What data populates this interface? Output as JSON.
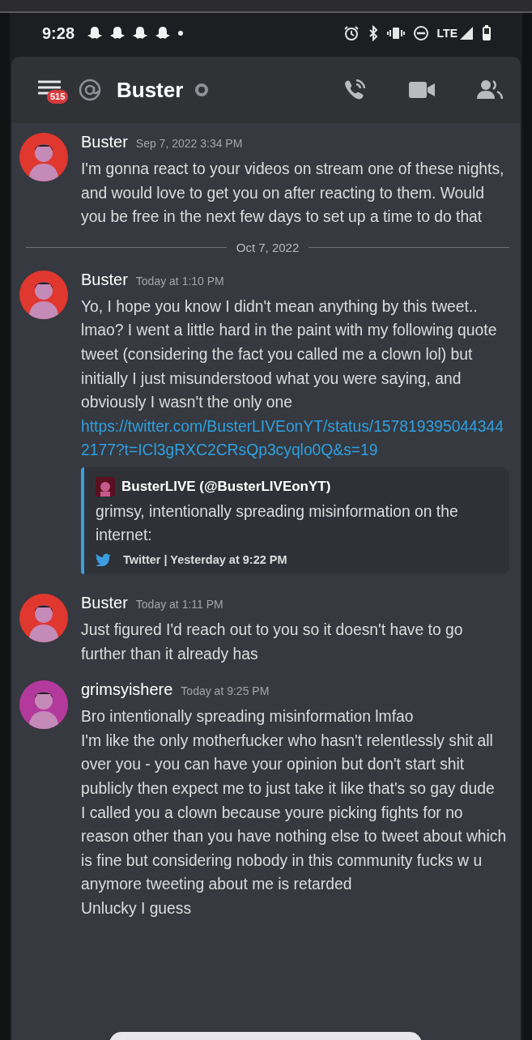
{
  "status_bar": {
    "time": "9:28",
    "network": "LTE"
  },
  "header": {
    "badge": "515",
    "title": "Buster"
  },
  "feed": [
    {
      "kind": "message",
      "author": "Buster",
      "timestamp": "Sep 7, 2022 3:34 PM",
      "color": "#e0372e",
      "lines": [
        "I'm gonna react to your videos on stream one of these nights, and would love to get you on after reacting to them. Would you be free in the next few days to set up a time to do that"
      ]
    },
    {
      "kind": "divider",
      "label": "Oct 7, 2022"
    },
    {
      "kind": "message",
      "author": "Buster",
      "timestamp": "Today at 1:10 PM",
      "color": "#e0372e",
      "lines": [
        "Yo, I hope you know I didn't mean anything by this tweet.. lmao? I went a little hard in the paint with my following quote tweet (considering the fact you called me a clown lol) but initially I just misunderstood what you were saying, and obviously I wasn't the only one"
      ],
      "link": "https://twitter.com/BusterLIVEonYT/status/1578193950443442177?t=ICl3gRXC2CRsQp3cyqlo0Q&s=19",
      "embed": {
        "author": "BusterLIVE (@BusterLIVEonYT)",
        "description": "grimsy, intentionally spreading misinformation on the internet:",
        "footer": "Twitter | Yesterday at 9:22 PM"
      }
    },
    {
      "kind": "message",
      "author": "Buster",
      "timestamp": "Today at 1:11 PM",
      "color": "#e0372e",
      "lines": [
        "Just figured I'd reach out to you so it doesn't have to go further than it already has"
      ]
    },
    {
      "kind": "message",
      "author": "grimsyishere",
      "timestamp": "Today at 9:25 PM",
      "color": "#b33a9c",
      "lines": [
        "Bro intentionally spreading misinformation lmfao",
        "I'm like the only motherfucker who hasn't relentlessly shit all over you - you can have your opinion but don't start shit publicly then expect me to just take it like that's so gay dude",
        "I called you a clown because youre picking fights for no reason other than you have nothing else to tweet about which is fine but considering nobody in this community fucks w u anymore tweeting about me is retarded",
        "Unlucky I guess"
      ]
    }
  ]
}
